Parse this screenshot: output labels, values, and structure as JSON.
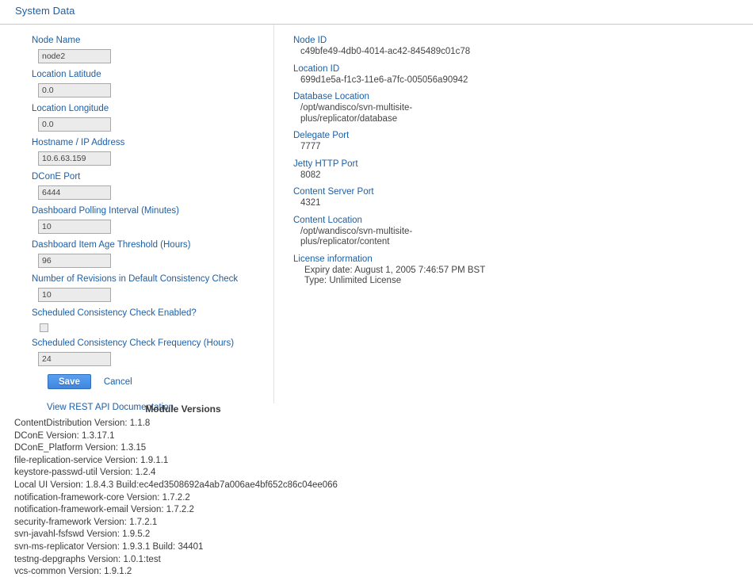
{
  "tab": {
    "label": "System Data"
  },
  "form": {
    "fields": [
      {
        "label": "Node Name",
        "value": "node2",
        "type": "text"
      },
      {
        "label": "Location Latitude",
        "value": "0.0",
        "type": "text"
      },
      {
        "label": "Location Longitude",
        "value": "0.0",
        "type": "text"
      },
      {
        "label": "Hostname / IP Address",
        "value": "10.6.63.159",
        "type": "text"
      },
      {
        "label": "DConE Port",
        "value": "6444",
        "type": "text"
      },
      {
        "label": "Dashboard Polling Interval (Minutes)",
        "value": "10",
        "type": "text"
      },
      {
        "label": "Dashboard Item Age Threshold (Hours)",
        "value": "96",
        "type": "text"
      },
      {
        "label": "Number of Revisions in Default Consistency Check",
        "value": "10",
        "type": "text"
      },
      {
        "label": "Scheduled Consistency Check Enabled?",
        "value": "",
        "type": "checkbox",
        "checked": false
      },
      {
        "label": "Scheduled Consistency Check Frequency (Hours)",
        "value": "24",
        "type": "text"
      }
    ],
    "save_label": "Save",
    "cancel_label": "Cancel",
    "rest_link_label": "View REST API Documentation"
  },
  "info": {
    "items": [
      {
        "label": "Node ID",
        "value": "c49bfe49-4db0-4014-ac42-845489c01c78"
      },
      {
        "label": "Location ID",
        "value": "699d1e5a-f1c3-11e6-a7fc-005056a90942"
      },
      {
        "label": "Database Location",
        "value": "/opt/wandisco/svn-multisite-\nplus/replicator/database"
      },
      {
        "label": "Delegate Port",
        "value": "7777"
      },
      {
        "label": "Jetty HTTP Port",
        "value": "8082"
      },
      {
        "label": "Content Server Port",
        "value": "4321"
      },
      {
        "label": "Content Location",
        "value": "/opt/wandisco/svn-multisite-\nplus/replicator/content"
      }
    ],
    "license": {
      "label": "License information",
      "expiry": "Expiry date: August 1, 2005 7:46:57 PM BST",
      "type": "Type: Unlimited License"
    }
  },
  "modules": {
    "title": "Module Versions",
    "lines": [
      "ContentDistribution Version: 1.1.8",
      "DConE Version: 1.3.17.1",
      "DConE_Platform Version: 1.3.15",
      "file-replication-service Version: 1.9.1.1",
      "keystore-passwd-util Version: 1.2.4",
      "Local UI Version: 1.8.4.3 Build:ec4ed3508692a4ab7a006ae4bf652c86c04ee066",
      "notification-framework-core Version: 1.7.2.2",
      "notification-framework-email Version: 1.7.2.2",
      "security-framework Version: 1.7.2.1",
      "svn-javahl-fsfswd Version: 1.9.5.2",
      "svn-ms-replicator Version: 1.9.3.1 Build: 34401",
      "testng-depgraphs Version: 1.0.1:test",
      "vcs-common Version: 1.9.1.2"
    ]
  },
  "colors": {
    "link": "#1b5fa8",
    "text": "#3a3a3a",
    "input_bg": "#ebebeb",
    "input_border": "#a8a8a8",
    "button_blue": "#3f86e0",
    "divider": "#c9c9c9"
  }
}
